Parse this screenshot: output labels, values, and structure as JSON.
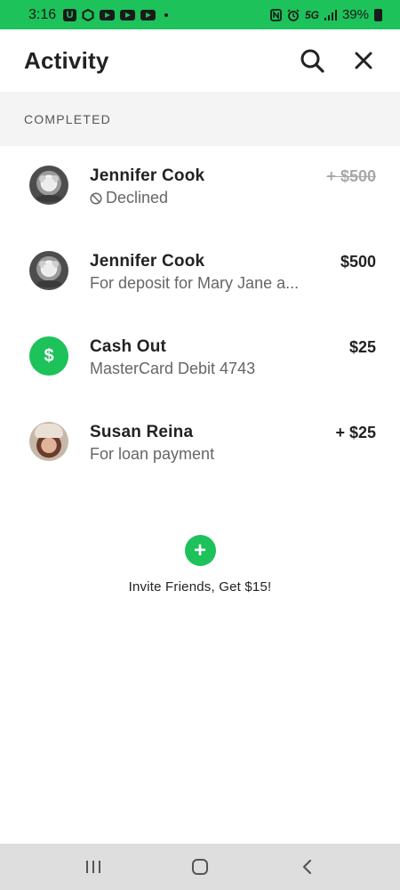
{
  "status_bar": {
    "time": "3:16",
    "network": "5G",
    "battery": "39%"
  },
  "header": {
    "title": "Activity",
    "icons": [
      "search-icon",
      "close-icon"
    ]
  },
  "section": {
    "label": "COMPLETED"
  },
  "activity": [
    {
      "name": "Jennifer Cook",
      "sub": "Declined",
      "amount": "+ $500",
      "status": "declined",
      "avatar": "dog-photo"
    },
    {
      "name": "Jennifer Cook",
      "sub": "For deposit for Mary Jane a...",
      "amount": "$500",
      "avatar": "dog-photo"
    },
    {
      "name": "Cash Out",
      "sub": "MasterCard Debit 4743",
      "amount": "$25",
      "avatar_symbol": "$"
    },
    {
      "name": "Susan Reina",
      "sub": "For loan payment",
      "amount": "+ $25",
      "avatar": "person-photo"
    }
  ],
  "invite": {
    "symbol": "+",
    "label": "Invite Friends, Get $15!"
  },
  "nav": {
    "icons": [
      "recent-apps-icon",
      "home-icon",
      "back-icon"
    ]
  },
  "colors": {
    "accent": "#1dc25a",
    "section_bg": "#f4f4f4",
    "nav_bg": "#dedede"
  }
}
